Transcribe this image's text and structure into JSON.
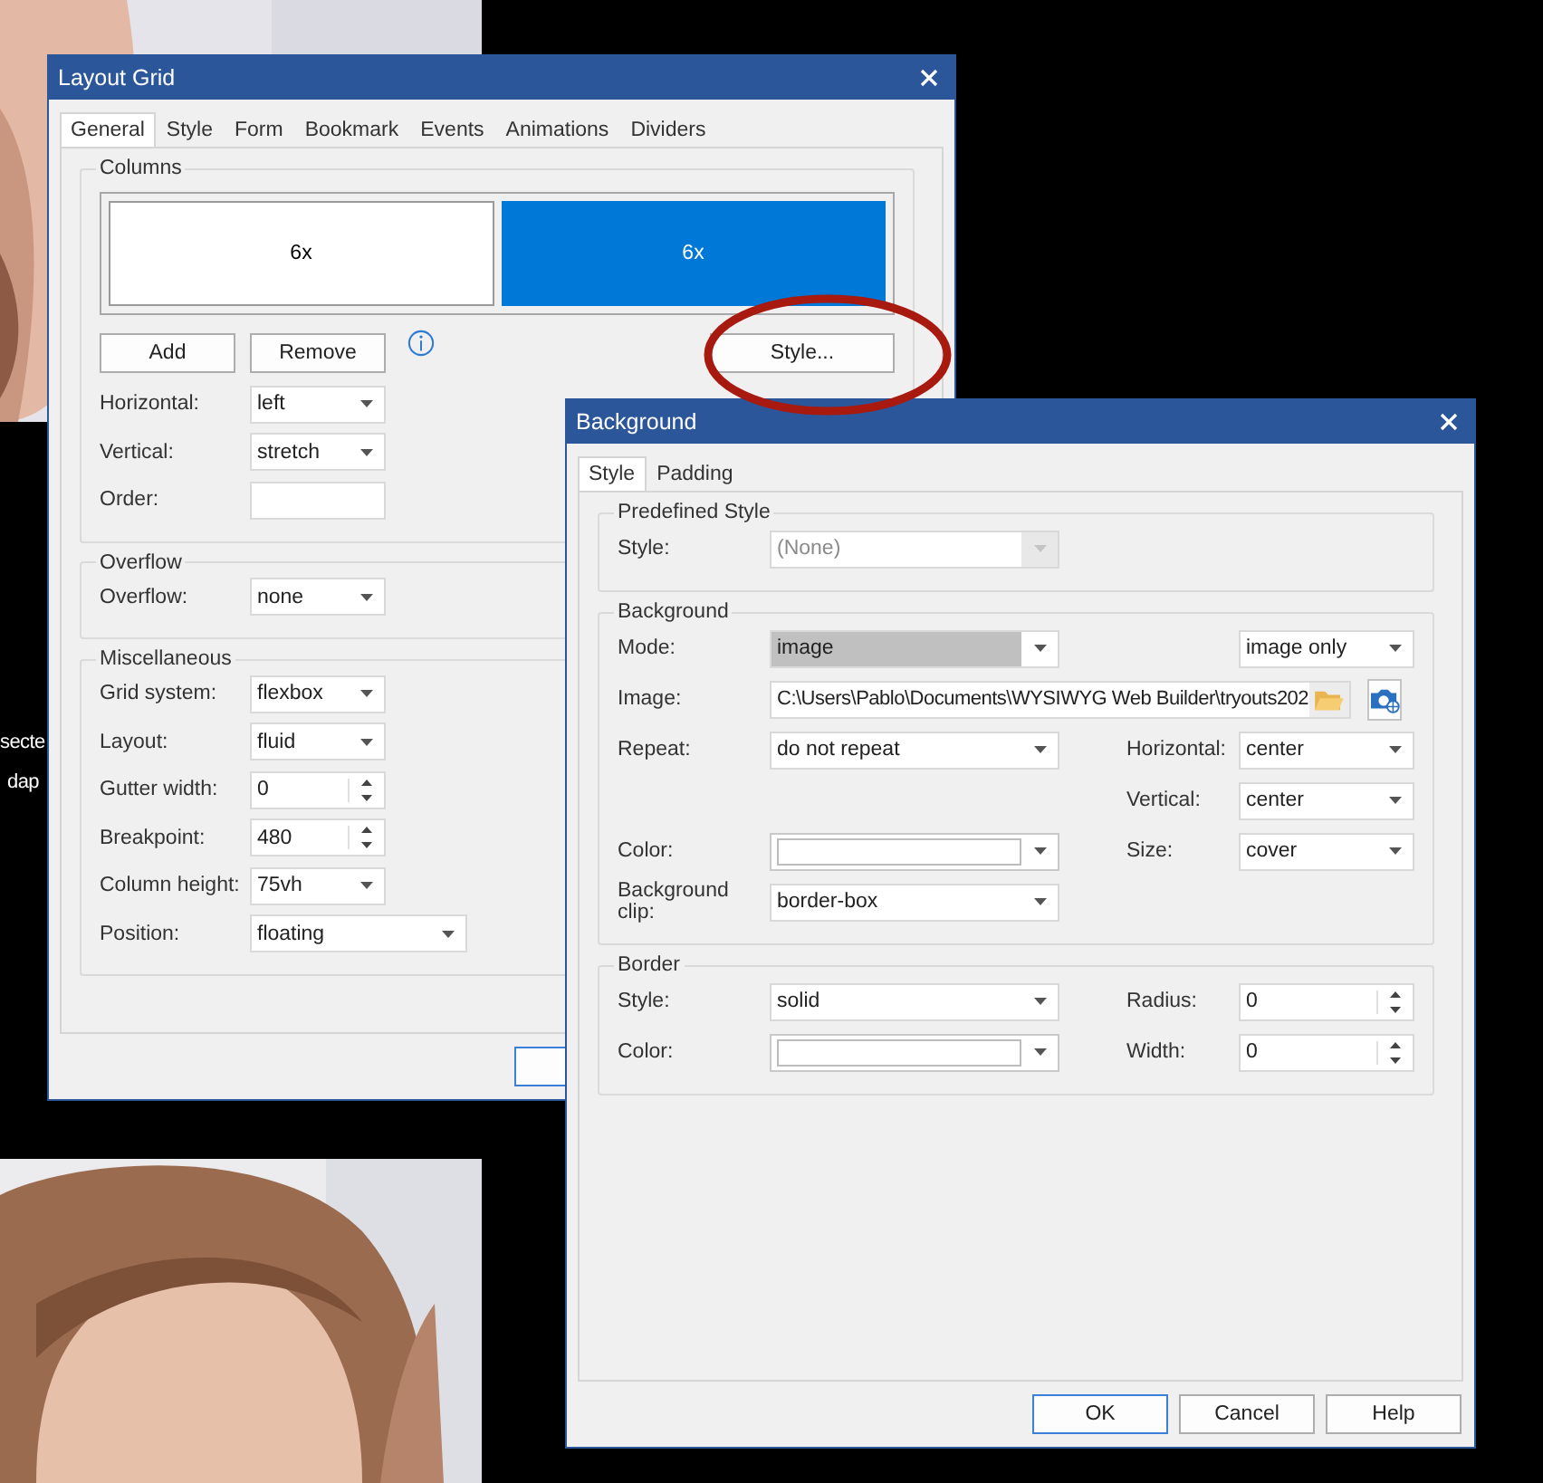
{
  "canvas_texts": [
    "secte",
    "dap"
  ],
  "dialogs": [
    {
      "title": "Layout Grid",
      "tabs": [
        {
          "label": "General",
          "selected": true
        },
        {
          "label": "Style",
          "selected": false
        },
        {
          "label": "Form",
          "selected": false
        },
        {
          "label": "Bookmark",
          "selected": false
        },
        {
          "label": "Events",
          "selected": false
        },
        {
          "label": "Animations",
          "selected": false
        },
        {
          "label": "Dividers",
          "selected": false
        }
      ],
      "groups": [
        {
          "legend": "Columns",
          "columns": [
            {
              "label": "6x",
              "selected": false
            },
            {
              "label": "6x",
              "selected": true
            }
          ],
          "buttons": [
            "Add",
            "Remove"
          ],
          "style_button": "Style...",
          "rows": [
            {
              "left": {
                "label": "Horizontal:",
                "kind": "dropdown",
                "value": "left"
              }
            },
            {
              "left": {
                "label": "Vertical:",
                "kind": "dropdown",
                "value": "stretch"
              }
            },
            {
              "left": {
                "label": "Order:",
                "kind": "text"
              }
            }
          ]
        },
        {
          "legend": "Overflow",
          "rows": [
            {
              "left": {
                "label": "Overflow:",
                "kind": "dropdown",
                "value": "none"
              }
            }
          ]
        },
        {
          "legend": "Miscellaneous",
          "rows": [
            {
              "left": {
                "label": "Grid system:",
                "kind": "dropdown",
                "value": "flexbox"
              }
            },
            {
              "left": {
                "label": "Layout:",
                "kind": "dropdown",
                "value": "fluid"
              }
            },
            {
              "left": {
                "label": "Gutter width:",
                "kind": "spinner",
                "value": "0"
              }
            },
            {
              "left": {
                "label": "Breakpoint:",
                "kind": "spinner",
                "value": "480"
              }
            },
            {
              "left": {
                "label": "Column height:",
                "kind": "dropdown",
                "value": "75vh"
              }
            },
            {
              "left": {
                "label": "Position:",
                "kind": "dropdown",
                "value": "floating"
              }
            }
          ]
        }
      ]
    },
    {
      "title": "Background",
      "tabs": [
        {
          "label": "Style",
          "selected": true
        },
        {
          "label": "Padding",
          "selected": false
        }
      ],
      "groups": [
        {
          "legend": "Predefined Style",
          "rows": [
            {
              "left": {
                "label": "Style:",
                "kind": "dropdown",
                "value": "(None)",
                "disabled": true,
                "highlighted": false
              }
            }
          ]
        },
        {
          "legend": "Background",
          "rows": [
            {
              "left": {
                "label": "Mode:",
                "kind": "dropdown",
                "value": "image",
                "disabled": false,
                "highlighted": true
              },
              "right": {
                "kind": "dropdown",
                "value": "image only",
                "disabled": false,
                "highlighted": false
              }
            },
            {
              "left": {
                "label": "Image:",
                "kind": "path",
                "value": "C:\\Users\\Pablo\\Documents\\WYSIWYG Web Builder\\tryouts202"
              }
            },
            {
              "left": {
                "label": "Repeat:",
                "kind": "dropdown",
                "value": "do not repeat",
                "disabled": false,
                "highlighted": false
              },
              "right": {
                "label": "Horizontal:",
                "kind": "dropdown",
                "value": "center",
                "disabled": false,
                "highlighted": false
              }
            },
            {
              "right": {
                "label": "Vertical:",
                "kind": "dropdown",
                "value": "center",
                "disabled": false,
                "highlighted": false
              }
            },
            {
              "left": {
                "label": "Color:",
                "kind": "color"
              },
              "right": {
                "label": "Size:",
                "kind": "dropdown",
                "value": "cover",
                "disabled": false,
                "highlighted": false
              }
            },
            {
              "left": {
                "label": "Background clip:",
                "kind": "dropdown",
                "value": "border-box",
                "disabled": false,
                "highlighted": false
              }
            }
          ]
        },
        {
          "legend": "Border",
          "rows": [
            {
              "left": {
                "label": "Style:",
                "kind": "dropdown",
                "value": "solid",
                "disabled": false,
                "highlighted": false
              },
              "right": {
                "label": "Radius:",
                "kind": "spinner",
                "value": "0"
              }
            },
            {
              "left": {
                "label": "Color:",
                "kind": "color"
              },
              "right": {
                "label": "Width:",
                "kind": "spinner",
                "value": "0"
              }
            }
          ]
        }
      ],
      "buttons": [
        {
          "label": "OK",
          "default": true
        },
        {
          "label": "Cancel",
          "default": false
        },
        {
          "label": "Help",
          "default": false
        }
      ]
    }
  ]
}
